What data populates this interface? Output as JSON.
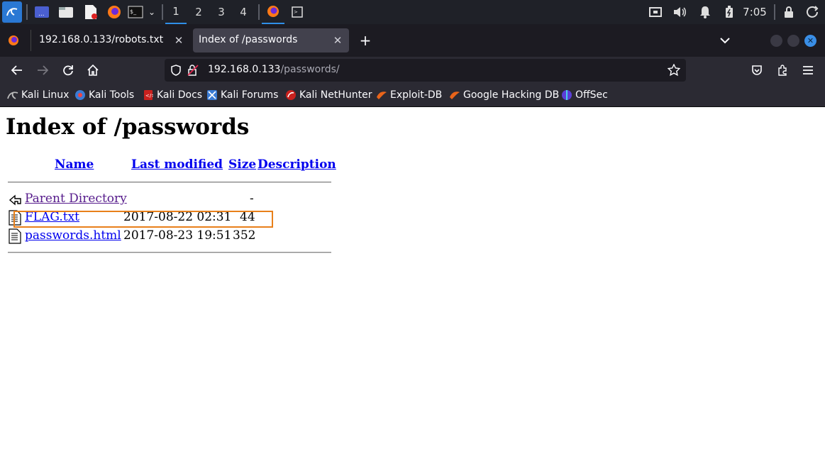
{
  "taskbar": {
    "workspaces": [
      "1",
      "2",
      "3",
      "4"
    ],
    "active_workspace": "1",
    "clock": "7:05",
    "icons": [
      "kali-menu-icon",
      "desktop-icon",
      "file-manager-icon",
      "text-editor-icon",
      "firefox-icon",
      "terminal-icon",
      "dropdown-icon",
      "network-icon",
      "volume-icon",
      "bell-icon",
      "battery-icon",
      "lock-icon",
      "power-icon"
    ]
  },
  "browser": {
    "tabs": [
      {
        "label": "192.168.0.133/robots.txt",
        "active": false
      },
      {
        "label": "Index of /passwords",
        "active": true
      }
    ],
    "url": {
      "host": "192.168.0.133",
      "path": "/passwords/"
    },
    "bookmarks": [
      "Kali Linux",
      "Kali Tools",
      "Kali Docs",
      "Kali Forums",
      "Kali NetHunter",
      "Exploit-DB",
      "Google Hacking DB",
      "OffSec"
    ]
  },
  "page": {
    "title": "Index of /passwords",
    "columns": {
      "name": "Name",
      "modified": "Last modified",
      "size": "Size",
      "description": "Description"
    },
    "rows": [
      {
        "name": "Parent Directory",
        "modified": "",
        "size": "-",
        "icon": "back-icon",
        "visited": true
      },
      {
        "name": "FLAG.txt",
        "modified": "2017-08-22 02:31",
        "size": "44",
        "icon": "text-file-icon",
        "visited": false
      },
      {
        "name": "passwords.html",
        "modified": "2017-08-23 19:51",
        "size": "352",
        "icon": "text-file-icon",
        "visited": false
      }
    ],
    "highlight_color": "#e8801a"
  }
}
